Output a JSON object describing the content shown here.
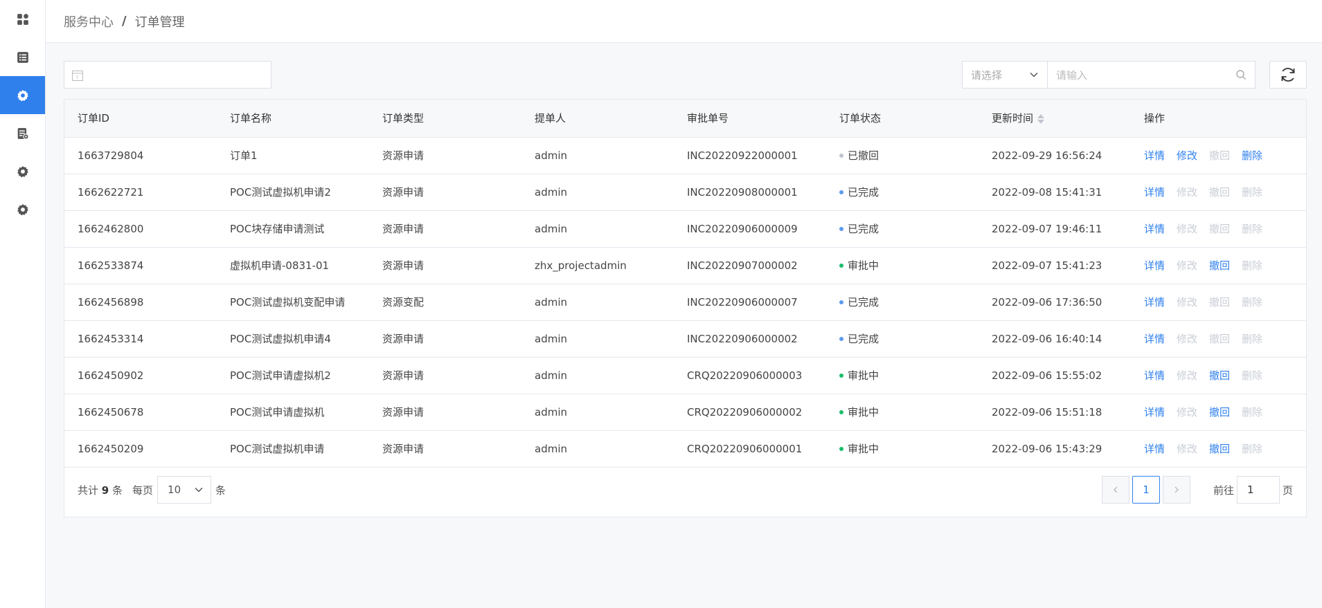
{
  "breadcrumb": {
    "root": "服务中心",
    "separator": "/",
    "current": "订单管理"
  },
  "toolbar": {
    "select_placeholder": "请选择",
    "search_placeholder": "请输入"
  },
  "table": {
    "columns": [
      "订单ID",
      "订单名称",
      "订单类型",
      "提单人",
      "审批单号",
      "订单状态",
      "更新时间",
      "操作"
    ],
    "actions": [
      "详情",
      "修改",
      "撤回",
      "删除"
    ],
    "rows": [
      {
        "id": "1663729804",
        "name": "订单1",
        "type": "资源申请",
        "submitter": "admin",
        "approval_no": "INC20220922000001",
        "status": "已撤回",
        "status_color": "#c0c4cc",
        "updated": "2022-09-29 16:56:24",
        "enabled": [
          true,
          true,
          false,
          true
        ]
      },
      {
        "id": "1662622721",
        "name": "POC测试虚拟机申请2",
        "type": "资源申请",
        "submitter": "admin",
        "approval_no": "INC20220908000001",
        "status": "已完成",
        "status_color": "#5b9bed",
        "updated": "2022-09-08 15:41:31",
        "enabled": [
          true,
          false,
          false,
          false
        ]
      },
      {
        "id": "1662462800",
        "name": "POC块存储申请测试",
        "type": "资源申请",
        "submitter": "admin",
        "approval_no": "INC20220906000009",
        "status": "已完成",
        "status_color": "#5b9bed",
        "updated": "2022-09-07 19:46:11",
        "enabled": [
          true,
          false,
          false,
          false
        ]
      },
      {
        "id": "1662533874",
        "name": "虚拟机申请-0831-01",
        "type": "资源申请",
        "submitter": "zhx_projectadmin",
        "approval_no": "INC20220907000002",
        "status": "审批中",
        "status_color": "#19be6b",
        "updated": "2022-09-07 15:41:23",
        "enabled": [
          true,
          false,
          true,
          false
        ]
      },
      {
        "id": "1662456898",
        "name": "POC测试虚拟机变配申请",
        "type": "资源变配",
        "submitter": "admin",
        "approval_no": "INC20220906000007",
        "status": "已完成",
        "status_color": "#5b9bed",
        "updated": "2022-09-06 17:36:50",
        "enabled": [
          true,
          false,
          false,
          false
        ]
      },
      {
        "id": "1662453314",
        "name": "POC测试虚拟机申请4",
        "type": "资源申请",
        "submitter": "admin",
        "approval_no": "INC20220906000002",
        "status": "已完成",
        "status_color": "#5b9bed",
        "updated": "2022-09-06 16:40:14",
        "enabled": [
          true,
          false,
          false,
          false
        ]
      },
      {
        "id": "1662450902",
        "name": "POC测试申请虚拟机2",
        "type": "资源申请",
        "submitter": "admin",
        "approval_no": "CRQ20220906000003",
        "status": "审批中",
        "status_color": "#19be6b",
        "updated": "2022-09-06 15:55:02",
        "enabled": [
          true,
          false,
          true,
          false
        ]
      },
      {
        "id": "1662450678",
        "name": "POC测试申请虚拟机",
        "type": "资源申请",
        "submitter": "admin",
        "approval_no": "CRQ20220906000002",
        "status": "审批中",
        "status_color": "#19be6b",
        "updated": "2022-09-06 15:51:18",
        "enabled": [
          true,
          false,
          true,
          false
        ]
      },
      {
        "id": "1662450209",
        "name": "POC测试虚拟机申请",
        "type": "资源申请",
        "submitter": "admin",
        "approval_no": "CRQ20220906000001",
        "status": "审批中",
        "status_color": "#19be6b",
        "updated": "2022-09-06 15:43:29",
        "enabled": [
          true,
          false,
          true,
          false
        ]
      }
    ]
  },
  "pagination": {
    "total_prefix": "共计",
    "total": "9",
    "total_suffix": "条",
    "per_page_label": "每页",
    "page_size": "10",
    "per_page_suffix": "条",
    "current_page": "1",
    "goto_label": "前往",
    "goto_value": "1",
    "goto_suffix": "页"
  },
  "colors": {
    "accent": "#2f80ed",
    "disabled": "#c8cdd5"
  }
}
